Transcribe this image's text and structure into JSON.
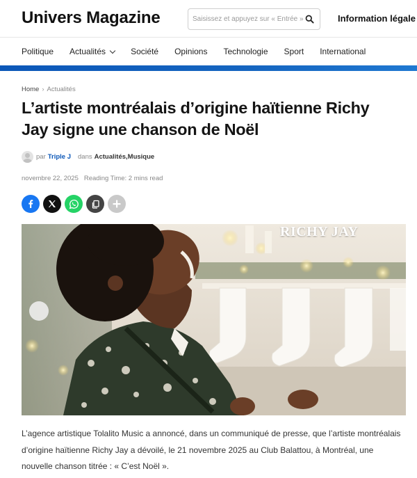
{
  "site": {
    "logo": "Univers Magazine",
    "search_placeholder": "Saisissez et appuyez sur « Entrée »",
    "legal_link": "Information légale"
  },
  "nav": {
    "items": [
      {
        "label": "Politique"
      },
      {
        "label": "Actualités",
        "has_dropdown": true
      },
      {
        "label": "Société"
      },
      {
        "label": "Opinions"
      },
      {
        "label": "Technologie"
      },
      {
        "label": "Sport"
      },
      {
        "label": "International"
      }
    ]
  },
  "breadcrumb": {
    "home": "Home",
    "current": "Actualités"
  },
  "article": {
    "title": "L’artiste montréalais d’origine haïtienne Richy Jay signe une chanson de Noël",
    "by_label": "par",
    "author": "Triple J",
    "in_label": "dans",
    "categories": [
      "Actualités",
      "Musique"
    ],
    "category_separator": ", ",
    "date": "novembre 22, 2025",
    "reading_time": "Reading Time: 2 mins read",
    "image_caption": "RICHY JAY",
    "intro": "L’agence artistique Tolalito Music a annoncé, dans un communiqué de presse, que l’artiste montréalais d’origine haïtienne Richy Jay a dévoilé, le 21 novembre 2025 au Club Balattou, à Montréal, une nouvelle chanson titrée : « C’est Noël »."
  },
  "share": {
    "buttons": [
      {
        "icon": "facebook-icon",
        "color": "#1877f2"
      },
      {
        "icon": "x-icon",
        "color": "#111111"
      },
      {
        "icon": "whatsapp-icon",
        "color": "#25d366"
      },
      {
        "icon": "copy-icon",
        "color": "#444444"
      },
      {
        "icon": "plus-icon",
        "color": "#c9c9c9"
      }
    ]
  },
  "colors": {
    "accent": "#0b57b8",
    "text": "#1a1a1a",
    "muted": "#888888"
  }
}
